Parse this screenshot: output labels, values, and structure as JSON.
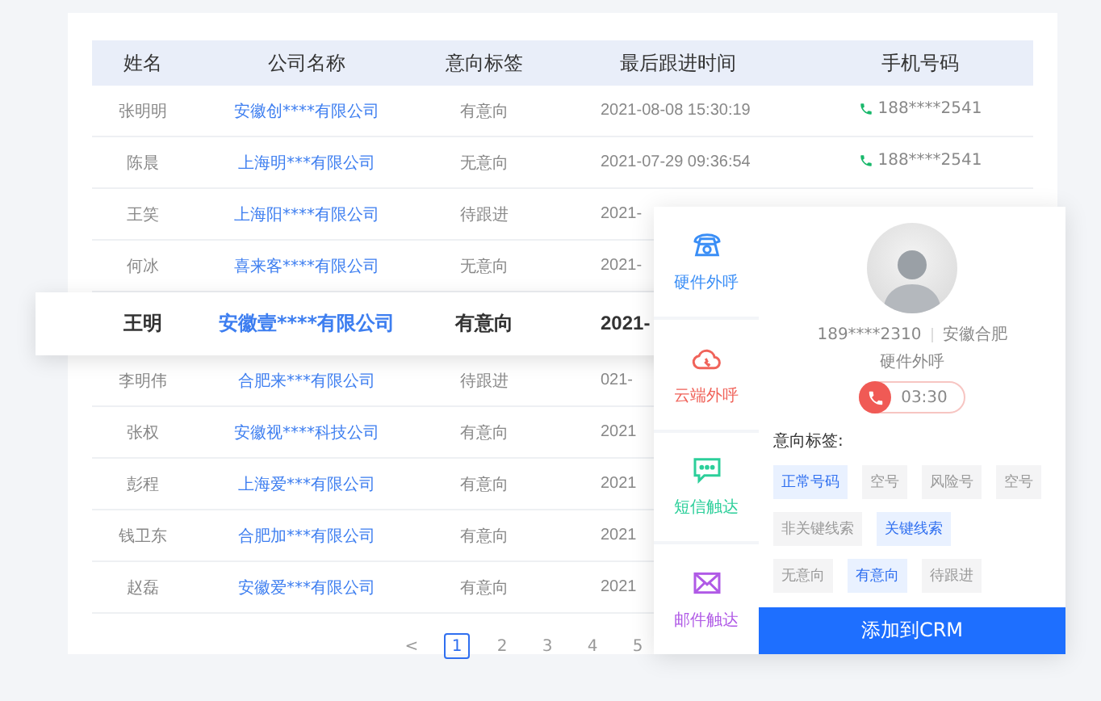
{
  "table": {
    "columns": [
      "姓名",
      "公司名称",
      "意向标签",
      "最后跟进时间",
      "手机号码"
    ],
    "rows": [
      {
        "name": "张明明",
        "company": "安徽创****有限公司",
        "tag": "有意向",
        "time": "2021-08-08  15:30:19",
        "phone": "188****2541",
        "selected": false
      },
      {
        "name": "陈晨",
        "company": "上海明***有限公司",
        "tag": "无意向",
        "time": "2021-07-29  09:36:54",
        "phone": "188****2541",
        "selected": false
      },
      {
        "name": "王笑",
        "company": "上海阳****有限公司",
        "tag": "待跟进",
        "time": "2021-",
        "selected": false
      },
      {
        "name": "何冰",
        "company": "喜来客****有限公司",
        "tag": "无意向",
        "time": "2021-",
        "selected": false
      },
      {
        "name": "王明",
        "company": "安徽壹****有限公司",
        "tag": "有意向",
        "time": "2021-",
        "selected": true
      },
      {
        "name": "李明伟",
        "company": "合肥来***有限公司",
        "tag": "待跟进",
        "time": "021-",
        "selected": false
      },
      {
        "name": "张权",
        "company": "安徽视****科技公司",
        "tag": "有意向",
        "time": "2021",
        "selected": false
      },
      {
        "name": "彭程",
        "company": "上海爱***有限公司",
        "tag": "有意向",
        "time": "2021",
        "selected": false
      },
      {
        "name": "钱卫东",
        "company": "合肥加***有限公司",
        "tag": "有意向",
        "time": "2021",
        "selected": false
      },
      {
        "name": "赵磊",
        "company": "安徽爱***有限公司",
        "tag": "有意向",
        "time": "2021",
        "selected": false
      }
    ]
  },
  "pagination": {
    "prev": "<",
    "pages": [
      {
        "label": "1",
        "selected": true
      },
      {
        "label": "2",
        "selected": false
      },
      {
        "label": "3",
        "selected": false
      },
      {
        "label": "4",
        "selected": false
      },
      {
        "label": "5",
        "selected": false
      }
    ]
  },
  "channels": [
    {
      "kind": "phone",
      "label": "硬件外呼",
      "color": "#3a8ef6"
    },
    {
      "kind": "cloud",
      "label": "云端外呼",
      "color": "#f0635a"
    },
    {
      "kind": "sms",
      "label": "短信触达",
      "color": "#2ccf9a"
    },
    {
      "kind": "mail",
      "label": "邮件触达",
      "color": "#b05ae6"
    }
  ],
  "contact": {
    "phone": "189****2310",
    "location": "安徽合肥",
    "call_type": "硬件外呼",
    "duration": "03:30"
  },
  "intent": {
    "title": "意向标签:",
    "tag_rows": [
      [
        {
          "label": "正常号码",
          "selected": true
        },
        {
          "label": "空号",
          "selected": false
        },
        {
          "label": "风险号",
          "selected": false
        },
        {
          "label": "空号",
          "selected": false
        }
      ],
      [
        {
          "label": "非关键线索",
          "selected": false
        },
        {
          "label": "关键线索",
          "selected": true
        }
      ],
      [
        {
          "label": "无意向",
          "selected": false
        },
        {
          "label": "有意向",
          "selected": true
        },
        {
          "label": "待跟进",
          "selected": false
        }
      ]
    ]
  },
  "action_button": "添加到CRM"
}
